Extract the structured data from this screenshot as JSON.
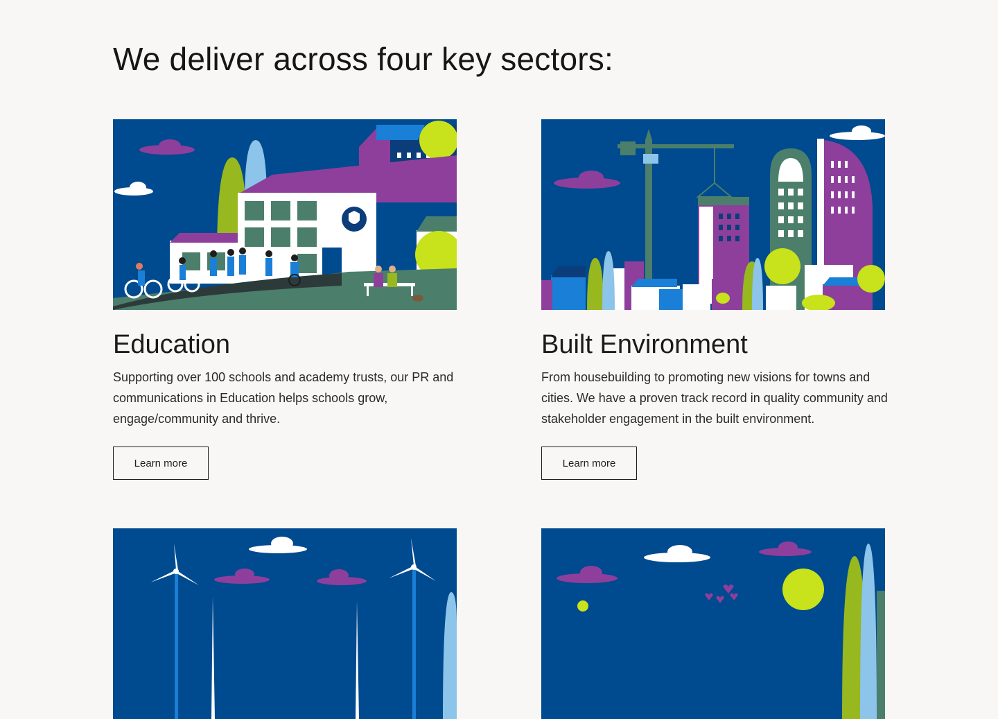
{
  "heading": "We deliver across four key sectors:",
  "cards": [
    {
      "title": "Education",
      "description": "Supporting over 100 schools and academy trusts, our PR and communications in Education helps schools grow, engage/community and thrive.",
      "button_label": "Learn more",
      "image": "education-illustration"
    },
    {
      "title": "Built Environment",
      "description": "From housebuilding to promoting new visions for towns and cities. We have a proven track record in quality community and stakeholder engagement in the built environment.",
      "button_label": "Learn more",
      "image": "built-environment-illustration"
    },
    {
      "image": "wind-energy-illustration"
    },
    {
      "image": "community-illustration"
    }
  ],
  "colors": {
    "background": "#f8f7f5",
    "navy": "#004a8f",
    "purple": "#8e3f9c",
    "green": "#97b81e",
    "lime": "#c8e21b",
    "sky": "#8cc4ea",
    "teal": "#4b7f6b"
  }
}
